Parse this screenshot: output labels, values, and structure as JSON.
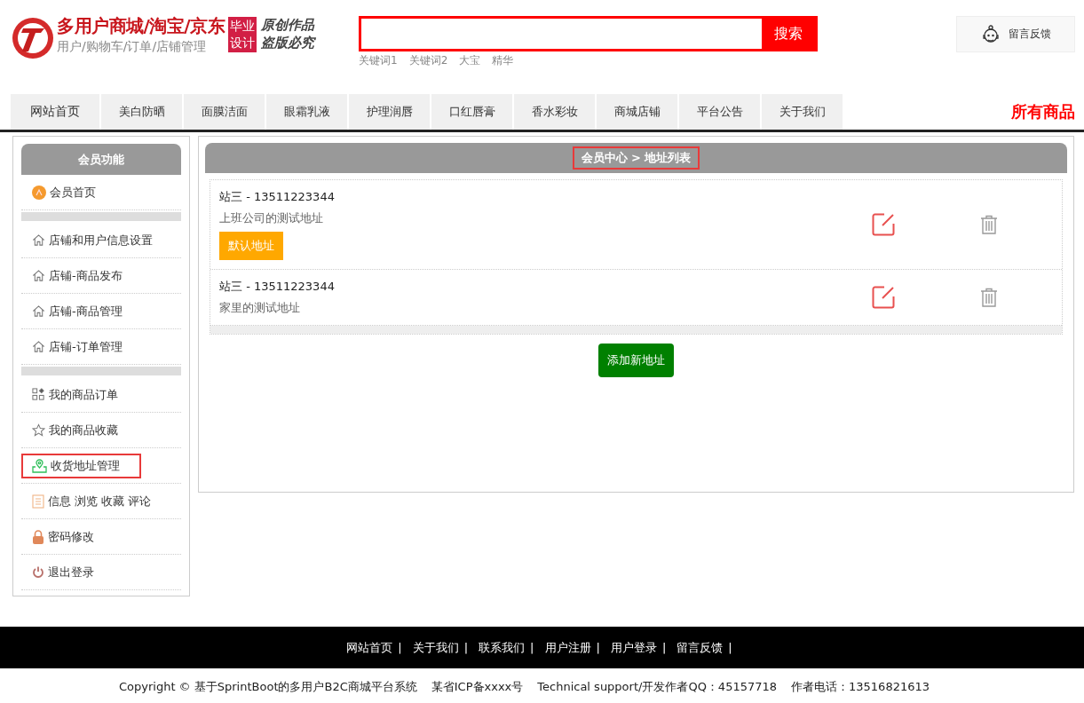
{
  "header": {
    "logo_title": "多用户商城/淘宝/京东",
    "logo_subtitle": "用户/购物车/订单/店铺管理",
    "badge_lines": [
      "毕业",
      "设计"
    ],
    "slogan_lines": [
      "原创作品",
      "盗版必究"
    ],
    "search": {
      "button": "搜索",
      "keywords": [
        "关键词1",
        "关键词2",
        "大宝",
        "精华"
      ]
    },
    "feedback_button": "留言反馈"
  },
  "nav": {
    "items": [
      "网站首页",
      "美白防晒",
      "面膜洁面",
      "眼霜乳液",
      "护理润唇",
      "口红唇膏",
      "香水彩妆",
      "商城店铺",
      "平台公告",
      "关于我们"
    ],
    "all_goods": "所有商品"
  },
  "sidebar": {
    "title": "会员功能",
    "groups": [
      [
        {
          "label": "会员首页",
          "kind": "member",
          "highlighted": false
        }
      ],
      [
        {
          "label": "店铺和用户信息设置",
          "kind": "house",
          "highlighted": false
        },
        {
          "label": "店铺-商品发布",
          "kind": "house",
          "highlighted": false
        },
        {
          "label": "店铺-商品管理",
          "kind": "house",
          "highlighted": false
        },
        {
          "label": "店铺-订单管理",
          "kind": "house",
          "highlighted": false
        }
      ],
      [
        {
          "label": "我的商品订单",
          "kind": "grid",
          "highlighted": false
        },
        {
          "label": "我的商品收藏",
          "kind": "star",
          "highlighted": false
        },
        {
          "label": "收货地址管理",
          "kind": "pin",
          "highlighted": true
        },
        {
          "label": "信息 浏览 收藏 评论",
          "kind": "doc",
          "highlighted": false
        },
        {
          "label": "密码修改",
          "kind": "lock",
          "highlighted": false
        },
        {
          "label": "退出登录",
          "kind": "power",
          "highlighted": false
        }
      ]
    ]
  },
  "main": {
    "breadcrumb": "会员中心 > 地址列表",
    "breadcrumb_highlighted": true,
    "addresses": [
      {
        "contact": "站三 - 13511223344",
        "address": "上班公司的测试地址",
        "default_badge": "默认地址"
      },
      {
        "contact": "站三 - 13511223344",
        "address": "家里的测试地址"
      }
    ],
    "add_button": "添加新地址"
  },
  "footer": {
    "links": [
      "网站首页",
      "关于我们",
      "联系我们",
      "用户注册",
      "用户登录",
      "留言反馈"
    ],
    "separators": [
      "|",
      "|",
      "|",
      "|",
      "|",
      "|"
    ],
    "copyright": "Copyright © 基于SprintBoot的多用户B2C商城平台系统",
    "icp": "某省ICP备xxxx号",
    "support": "Technical support/开发作者QQ：45157718",
    "phone": "作者电话：13516821613"
  }
}
